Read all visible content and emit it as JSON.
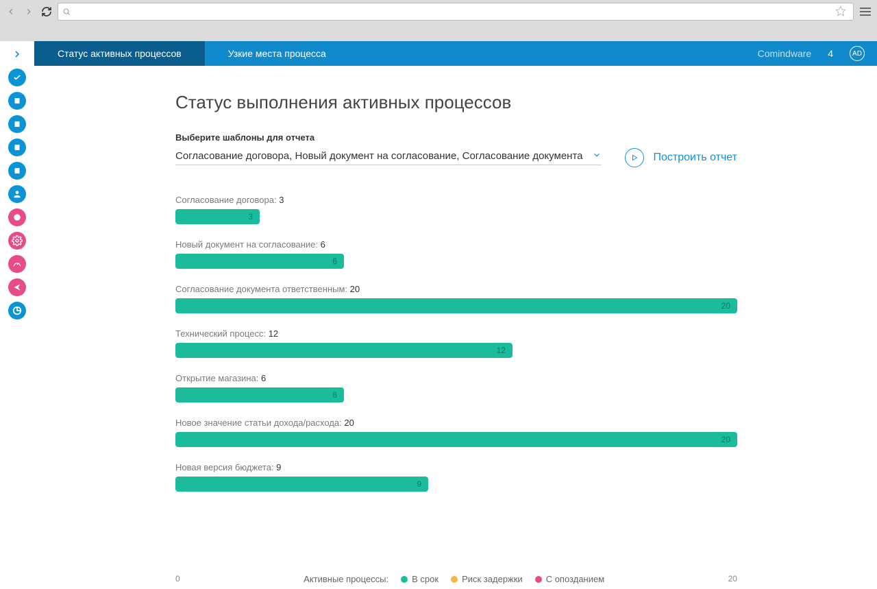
{
  "header": {
    "tabs": [
      "Статус активных процессов",
      "Узкие места процесса"
    ],
    "brand": "Comindware",
    "notif_count": "4",
    "avatar": "AD"
  },
  "page": {
    "title": "Статус выполнения активных процессов",
    "filter_label": "Выберите шаблоны для отчета",
    "select_value": "Согласование договора, Новый документ на согласование, Согласование документа",
    "build_label": "Построить отчет"
  },
  "legend": {
    "title": "Активные процессы:",
    "items": [
      {
        "label": "В срок",
        "color": "#1abc9c"
      },
      {
        "label": "Риск задержки",
        "color": "#f0b840"
      },
      {
        "label": "С опозданием",
        "color": "#e84b8a"
      }
    ]
  },
  "axis": {
    "min": "0",
    "max": "20"
  },
  "chart_data": {
    "type": "bar",
    "xlabel": "",
    "ylabel": "",
    "xlim": [
      0,
      20
    ],
    "categories": [
      "Согласование договора",
      "Новый документ на согласование",
      "Согласование документа ответственным",
      "Технический процесс",
      "Открытие магазина",
      "Новое значение статьи дохода/расхода",
      "Новая версия бюджета"
    ],
    "values": [
      3,
      6,
      20,
      12,
      6,
      20,
      9
    ],
    "title": "Статус выполнения активных процессов"
  }
}
